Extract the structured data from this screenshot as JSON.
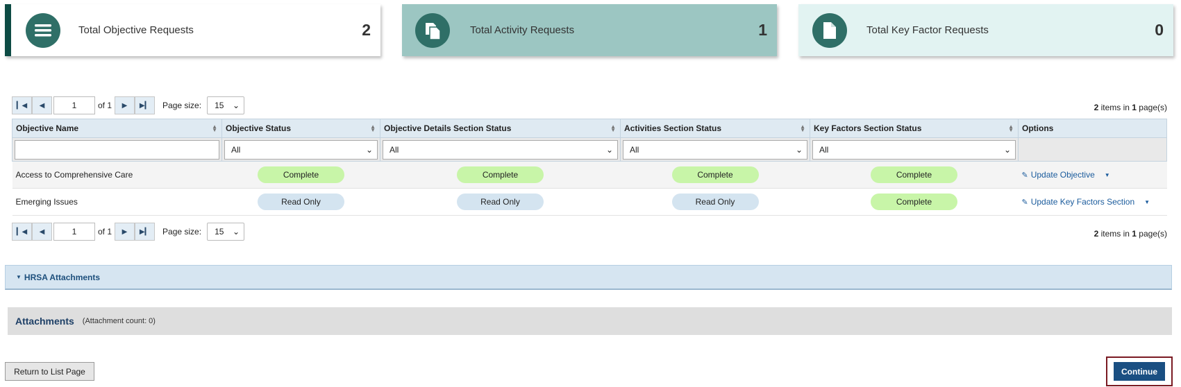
{
  "summary_cards": [
    {
      "label": "Total Objective Requests",
      "count": "2",
      "icon": "list-icon"
    },
    {
      "label": "Total Activity Requests",
      "count": "1",
      "icon": "documents-icon"
    },
    {
      "label": "Total Key Factor Requests",
      "count": "0",
      "icon": "document-icon"
    }
  ],
  "pager_top": {
    "page": "1",
    "of_label": "of 1",
    "page_size_label": "Page size:",
    "page_size": "15",
    "info_count": "2",
    "info_items": " items in ",
    "info_pages": "1",
    "info_suffix": " page(s)"
  },
  "pager_bottom": {
    "page": "1",
    "of_label": "of 1",
    "page_size_label": "Page size:",
    "page_size": "15",
    "info_count": "2",
    "info_items": " items in ",
    "info_pages": "1",
    "info_suffix": " page(s)"
  },
  "grid": {
    "columns": [
      "Objective Name",
      "Objective Status",
      "Objective Details Section Status",
      "Activities Section Status",
      "Key Factors Section Status",
      "Options"
    ],
    "filter_all": "All",
    "rows": [
      {
        "name": "Access to Comprehensive Care",
        "objective_status": "Complete",
        "details_status": "Complete",
        "activities_status": "Complete",
        "key_factors_status": "Complete",
        "option": "Update Objective"
      },
      {
        "name": "Emerging Issues",
        "objective_status": "Read Only",
        "details_status": "Read Only",
        "activities_status": "Read Only",
        "key_factors_status": "Complete",
        "option": "Update Key Factors Section"
      }
    ]
  },
  "hrsa_section": {
    "title": "HRSA Attachments"
  },
  "attachments": {
    "title": "Attachments",
    "count_label": "(Attachment count: 0)"
  },
  "buttons": {
    "return": "Return to List Page",
    "continue": "Continue"
  },
  "colors": {
    "brand_dark": "#0d4b44",
    "icon_circle": "#2f6f67",
    "complete": "#c8f5a8",
    "readonly": "#d4e4f0",
    "primary_button": "#1a4f82"
  }
}
